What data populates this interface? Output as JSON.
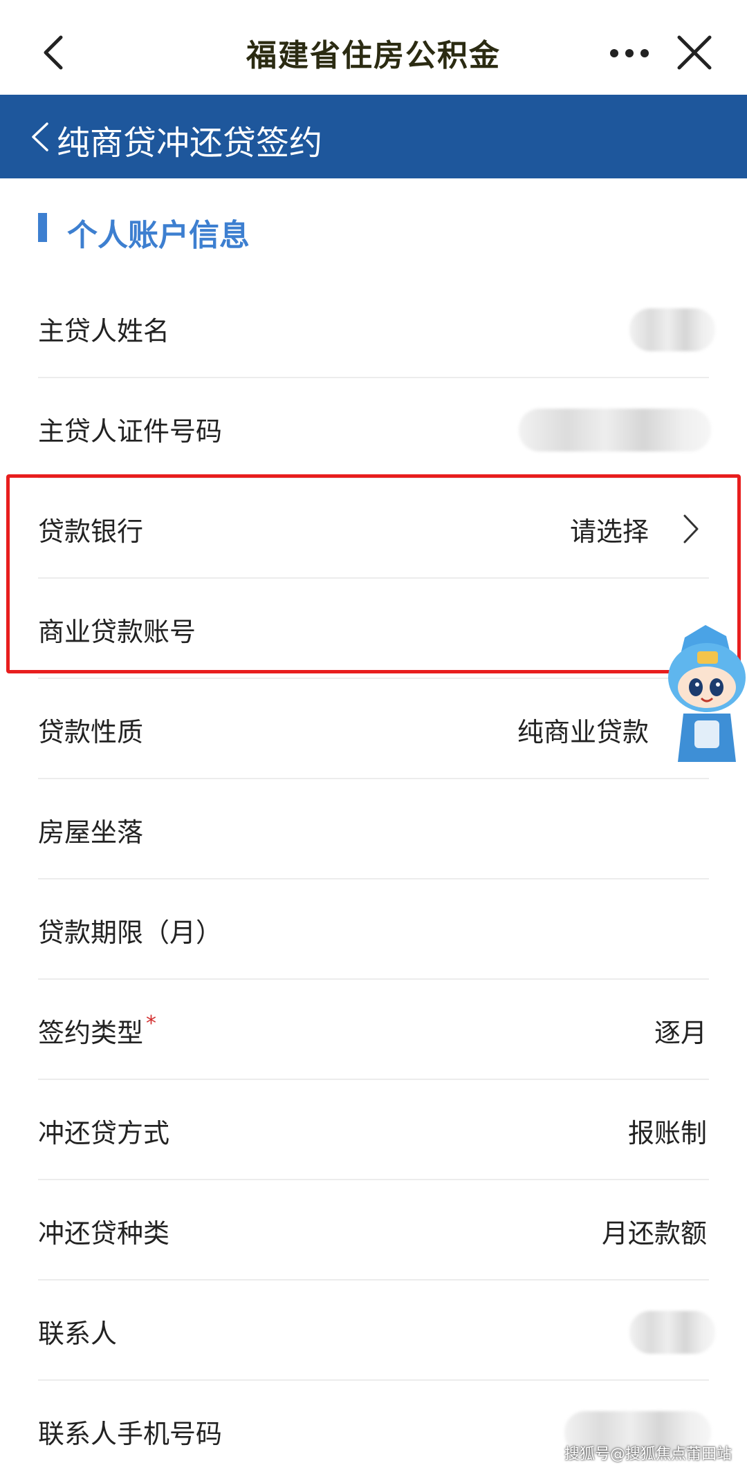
{
  "topbar": {
    "title": "福建省住房公积金",
    "back_icon": "chevron-left-icon",
    "more_icon": "more-dots-icon",
    "close_icon": "close-icon"
  },
  "subheader": {
    "title": "纯商贷冲还贷签约",
    "back_icon": "chevron-left-icon",
    "color": "#1e579c"
  },
  "section": {
    "title": "个人账户信息",
    "accent": "#3d7fd0"
  },
  "form": {
    "borrower_name_label": "主贷人姓名",
    "borrower_id_label": "主贷人证件号码",
    "loan_bank_label": "贷款银行",
    "loan_bank_value": "请选择",
    "commercial_account_label": "商业贷款账号",
    "loan_nature_label": "贷款性质",
    "loan_nature_value": "纯商业贷款",
    "house_location_label": "房屋坐落",
    "loan_term_label": "贷款期限（月）",
    "sign_type_label": "签约类型",
    "sign_type_required": "*",
    "sign_type_value": "逐月",
    "repay_method_label": "冲还贷方式",
    "repay_method_value": "报账制",
    "repay_kind_label": "冲还贷种类",
    "repay_kind_value": "月还款额",
    "contact_label": "联系人",
    "contact_phone_label": "联系人手机号码"
  },
  "watermark": "搜狐号@搜狐焦点莆田站",
  "highlight_color": "#e81e1e"
}
